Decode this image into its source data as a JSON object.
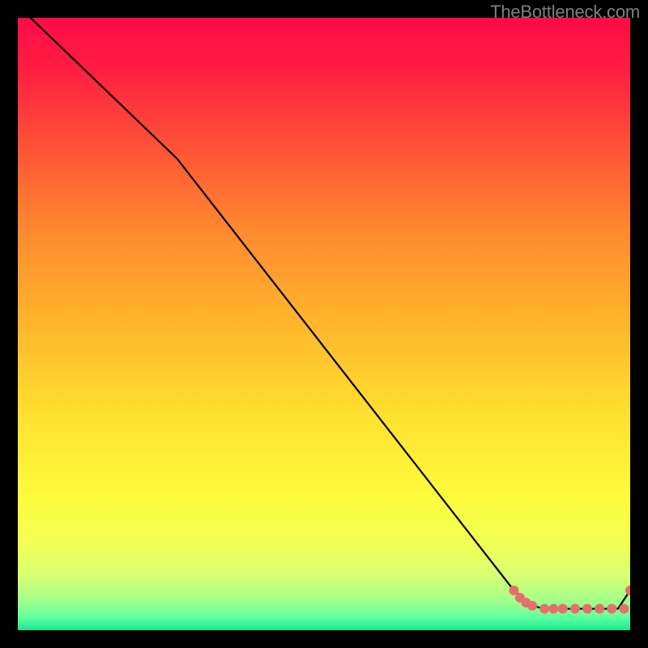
{
  "watermark": "TheBottleneck.com",
  "chart_data": {
    "type": "line",
    "title": "",
    "xlabel": "",
    "ylabel": "",
    "xlim": [
      0,
      100
    ],
    "ylim": [
      0,
      100
    ],
    "grid": false,
    "series": [
      {
        "name": "main-line",
        "color": "#000000",
        "x": [
          0,
          26,
          81,
          84,
          86,
          88,
          90,
          92,
          94,
          96,
          98,
          100
        ],
        "y": [
          102,
          77,
          6.5,
          4.0,
          3.5,
          3.5,
          3.5,
          3.5,
          3.5,
          3.5,
          3.5,
          6.5
        ]
      },
      {
        "name": "highlight-points",
        "color": "#e76f6a",
        "x": [
          81.0,
          82.0,
          83.0,
          84.0,
          86.0,
          87.5,
          89.0,
          91.0,
          93.0,
          95.0,
          97.0,
          99.0,
          100.0
        ],
        "y": [
          6.5,
          5.3,
          4.5,
          4.0,
          3.5,
          3.5,
          3.5,
          3.5,
          3.5,
          3.5,
          3.5,
          3.5,
          6.5
        ]
      }
    ]
  }
}
